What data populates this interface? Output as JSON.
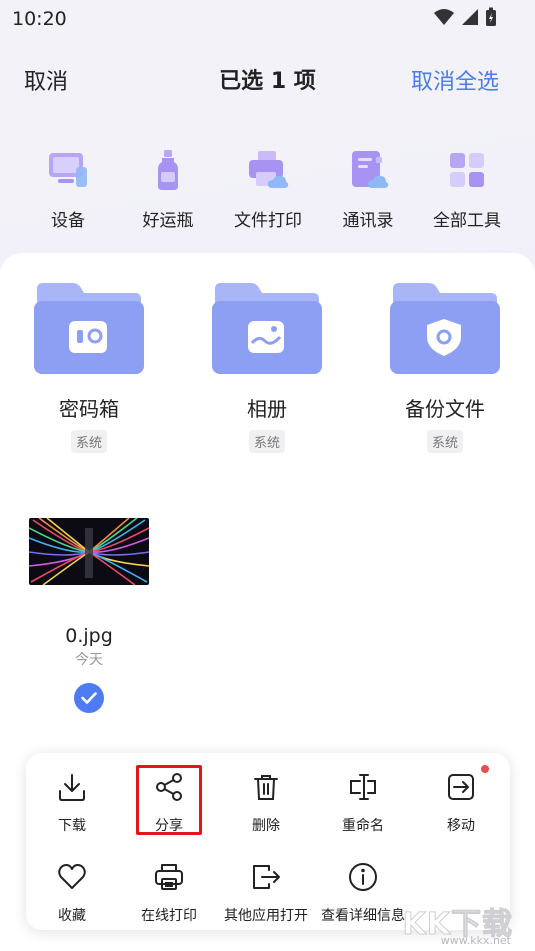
{
  "status": {
    "time": "10:20"
  },
  "header": {
    "cancel": "取消",
    "title": "已选 1 项",
    "deselect_all": "取消全选"
  },
  "tools": [
    {
      "label": "设备",
      "icon": "device-icon"
    },
    {
      "label": "好运瓶",
      "icon": "bottle-icon"
    },
    {
      "label": "文件打印",
      "icon": "printer-icon"
    },
    {
      "label": "通讯录",
      "icon": "contacts-icon"
    },
    {
      "label": "全部工具",
      "icon": "grid-icon"
    }
  ],
  "folders": [
    {
      "name": "密码箱",
      "tag": "系统",
      "icon": "safe-icon"
    },
    {
      "name": "相册",
      "tag": "系统",
      "icon": "photo-icon"
    },
    {
      "name": "备份文件",
      "tag": "系统",
      "icon": "shield-icon"
    }
  ],
  "file": {
    "name": "0.jpg",
    "date": "今天",
    "selected": true
  },
  "actions": [
    {
      "label": "下载",
      "icon": "download-icon"
    },
    {
      "label": "分享",
      "icon": "share-icon"
    },
    {
      "label": "删除",
      "icon": "trash-icon"
    },
    {
      "label": "重命名",
      "icon": "rename-icon"
    },
    {
      "label": "移动",
      "icon": "move-icon"
    },
    {
      "label": "收藏",
      "icon": "heart-icon"
    },
    {
      "label": "在线打印",
      "icon": "print-icon"
    },
    {
      "label": "其他应用打开",
      "icon": "open-with-icon"
    },
    {
      "label": "查看详细信息",
      "icon": "info-icon"
    }
  ],
  "colors": {
    "accent": "#4a7cf0",
    "folder": "#8fa0f4",
    "highlight": "#e0161b",
    "badge": "#f04a4a"
  },
  "watermark": {
    "text": "KK下载",
    "url": "www.kkx.net"
  }
}
